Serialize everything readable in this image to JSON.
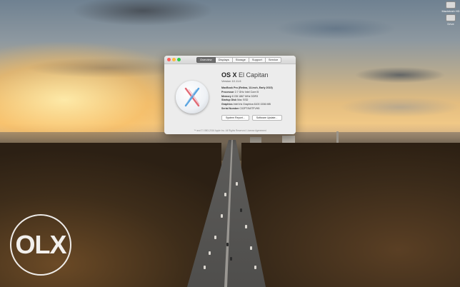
{
  "desktop": {
    "icons": [
      {
        "label": "Macintosh HD",
        "icon": "hard-drive-icon"
      },
      {
        "label": "Drive",
        "icon": "hard-drive-icon"
      }
    ]
  },
  "watermark": {
    "text": "OLX"
  },
  "about_window": {
    "tabs": [
      {
        "label": "Overview",
        "active": true
      },
      {
        "label": "Displays",
        "active": false
      },
      {
        "label": "Storage",
        "active": false
      },
      {
        "label": "Support",
        "active": false
      },
      {
        "label": "Service",
        "active": false
      }
    ],
    "os_name": "OS X",
    "os_release": "El Capitan",
    "version": "Version 10.11.6",
    "specs": [
      {
        "key": "MacBook Pro (Retina, 13-inch, Early 2015)",
        "value": ""
      },
      {
        "key": "Processor",
        "value": "2.7 GHz Intel Core i5"
      },
      {
        "key": "Memory",
        "value": "8 GB 1867 MHz DDR3"
      },
      {
        "key": "Startup Disk",
        "value": "Mac SSD"
      },
      {
        "key": "Graphics",
        "value": "Intel Iris Graphics 6100 1536 MB"
      },
      {
        "key": "Serial Number",
        "value": "C02PT4WTFVH5"
      }
    ],
    "buttons": [
      {
        "label": "System Report..."
      },
      {
        "label": "Software Update..."
      }
    ],
    "footer": "™ and © 1983-2016 Apple Inc. All Rights Reserved. License Agreement"
  },
  "colors": {
    "close": "#fc605c",
    "minimize": "#fdbc40",
    "zoom": "#34c84a",
    "tab_active": "#6d6d6d"
  }
}
